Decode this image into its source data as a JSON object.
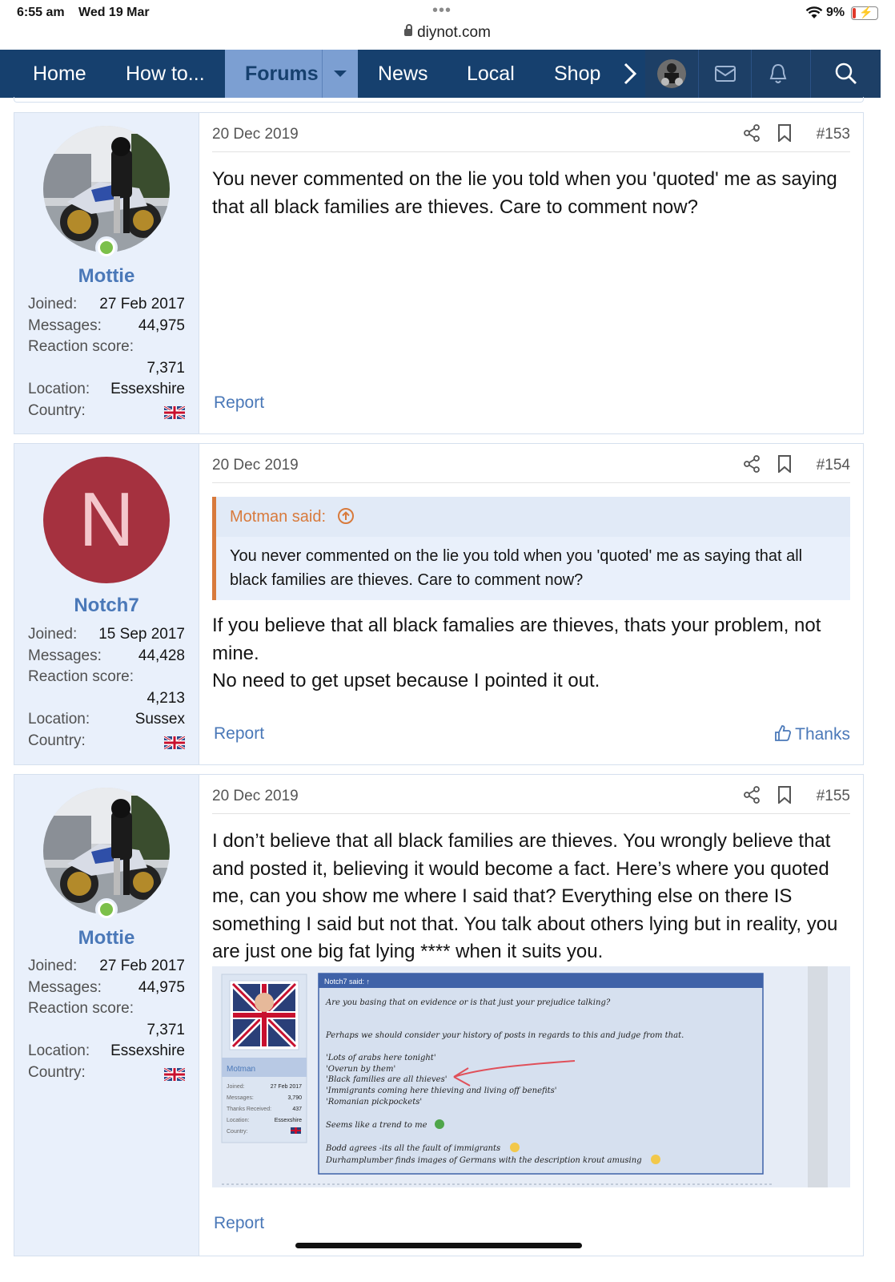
{
  "status_bar": {
    "time": "6:55 am",
    "date": "Wed 19 Mar",
    "url": "diynot.com",
    "battery": "9%"
  },
  "nav": {
    "items": [
      "Home",
      "How to...",
      "Forums",
      "News",
      "Local",
      "Shop"
    ]
  },
  "posts": [
    {
      "user": {
        "name": "Mottie",
        "joined": "27 Feb 2017",
        "messages": "44,975",
        "reaction_score": "7,371",
        "location": "Essexshire"
      },
      "labels": {
        "joined": "Joined:",
        "messages": "Messages:",
        "reaction": "Reaction score:",
        "location": "Location:",
        "country": "Country:"
      },
      "date": "20 Dec 2019",
      "number": "#153",
      "message": "You never commented on the lie you told when you 'quoted' me as saying that all black families are thieves. Care to comment now?",
      "report": "Report"
    },
    {
      "user": {
        "name": "Notch7",
        "initial": "N",
        "joined": "15 Sep 2017",
        "messages": "44,428",
        "reaction_score": "4,213",
        "location": "Sussex"
      },
      "labels": {
        "joined": "Joined:",
        "messages": "Messages:",
        "reaction": "Reaction score:",
        "location": "Location:",
        "country": "Country:"
      },
      "date": "20 Dec 2019",
      "number": "#154",
      "quote": {
        "author": "Motman said:",
        "text": "You never commented on the lie you told when you 'quoted' me as saying that all black families are thieves. Care to comment now?"
      },
      "message_line1": "If you believe that all black famalies are thieves, thats your problem, not mine.",
      "message_line2": "No need to get upset because I pointed it out.",
      "report": "Report",
      "thanks": "Thanks"
    },
    {
      "user": {
        "name": "Mottie",
        "joined": "27 Feb 2017",
        "messages": "44,975",
        "reaction_score": "7,371",
        "location": "Essexshire"
      },
      "labels": {
        "joined": "Joined:",
        "messages": "Messages:",
        "reaction": "Reaction score:",
        "location": "Location:",
        "country": "Country:"
      },
      "date": "20 Dec 2019",
      "number": "#155",
      "message": "I don’t believe that all black families are thieves. You wrongly believe that and posted it, believing it would become a fact. Here’s where you quoted me, can you show me where I said that? Everything else on there IS something I said but not that. You talk about others lying but in reality, you are just one big fat lying **** when it suits you.",
      "report": "Report",
      "screenshot": {
        "quote_header": "Notch7 said: ↑",
        "lines": [
          "Are you basing that on evidence or is that just your prejudice talking?",
          "Perhaps we should consider your history of posts in regards to this and judge from that.",
          "'Lots of arabs here tonight'",
          "'Overun by them'",
          "'Black families are all thieves'",
          "'Immigrants coming here thieving and living off benefits'",
          "'Romanian pickpockets'",
          "Seems like a trend to me",
          "Bodd agrees -its all the fault of immigrants",
          "Durhamplumber finds images of Germans with the description krout amusing"
        ],
        "user": {
          "name": "Motman",
          "joined": "27 Feb 2017",
          "messages": "3,790",
          "thanks": "437",
          "location": "Essexshire"
        },
        "labels": {
          "joined": "Joined:",
          "messages": "Messages:",
          "thanks": "Thanks Received:",
          "location": "Location:",
          "country": "Country:"
        }
      }
    }
  ]
}
